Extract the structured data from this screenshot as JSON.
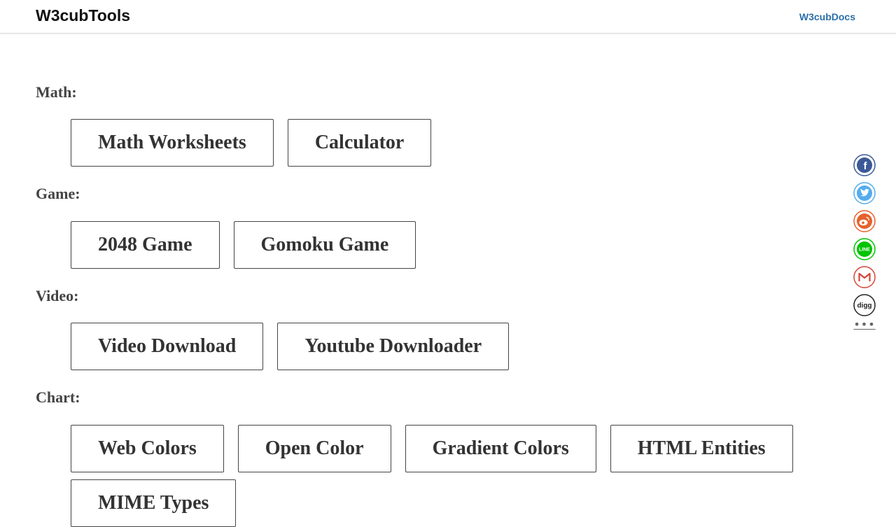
{
  "header": {
    "logo": "W3cubTools",
    "docs_link": "W3cubDocs"
  },
  "sections": [
    {
      "title": "Math:",
      "tools": [
        "Math Worksheets",
        "Calculator"
      ]
    },
    {
      "title": "Game:",
      "tools": [
        "2048 Game",
        "Gomoku Game"
      ]
    },
    {
      "title": "Video:",
      "tools": [
        "Video Download",
        "Youtube Downloader"
      ]
    },
    {
      "title": "Chart:",
      "tools": [
        "Web Colors",
        "Open Color",
        "Gradient Colors",
        "HTML Entities",
        "MIME Types"
      ]
    }
  ],
  "share": {
    "icons": [
      "facebook-icon",
      "twitter-icon",
      "weibo-icon",
      "line-icon",
      "gmail-icon",
      "digg-icon",
      "more-icon"
    ],
    "more_label": "•••",
    "line_label": "LINE",
    "digg_label": "digg",
    "facebook_label": "f",
    "colors": {
      "facebook": "#3b5998",
      "twitter": "#55acee",
      "weibo": "#e6622c",
      "line": "#00c300",
      "gmail": "#d44638",
      "digg": "#222222"
    }
  }
}
